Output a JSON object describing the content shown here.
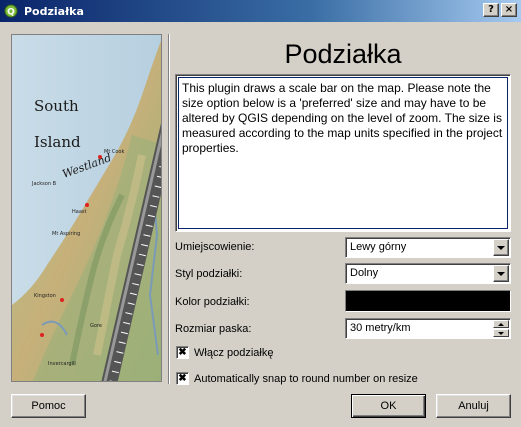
{
  "window": {
    "title": "Podziałka",
    "help_button": "?",
    "close_button": "×"
  },
  "map_image": {
    "labels": [
      "South",
      "Island",
      "Westland",
      "Jackson B",
      "Haast",
      "Mt Cook",
      "Mt Aspiring",
      "Kingston",
      "Gore",
      "Invercargill"
    ]
  },
  "heading": "Podziałka",
  "description": "This plugin draws a scale bar on the map. Please note the size option below is a 'preferred' size and may have to be altered by QGIS depending on the level of zoom.  The size is measured according to the map units specified in the project properties.",
  "form": {
    "placement_label": "Umiejscowienie:",
    "placement_value": "Lewy górny",
    "style_label": "Styl podziałki:",
    "style_value": "Dolny",
    "color_label": "Kolor podziałki:",
    "color_value": "#000000",
    "size_label": "Rozmiar paska:",
    "size_value": "30 metry/km",
    "enable_label": "Włącz podziałkę",
    "enable_checked": true,
    "snap_label": "Automatically snap to round number on resize",
    "snap_checked": true
  },
  "buttons": {
    "help": "Pomoc",
    "ok": "OK",
    "cancel": "Anuluj"
  }
}
